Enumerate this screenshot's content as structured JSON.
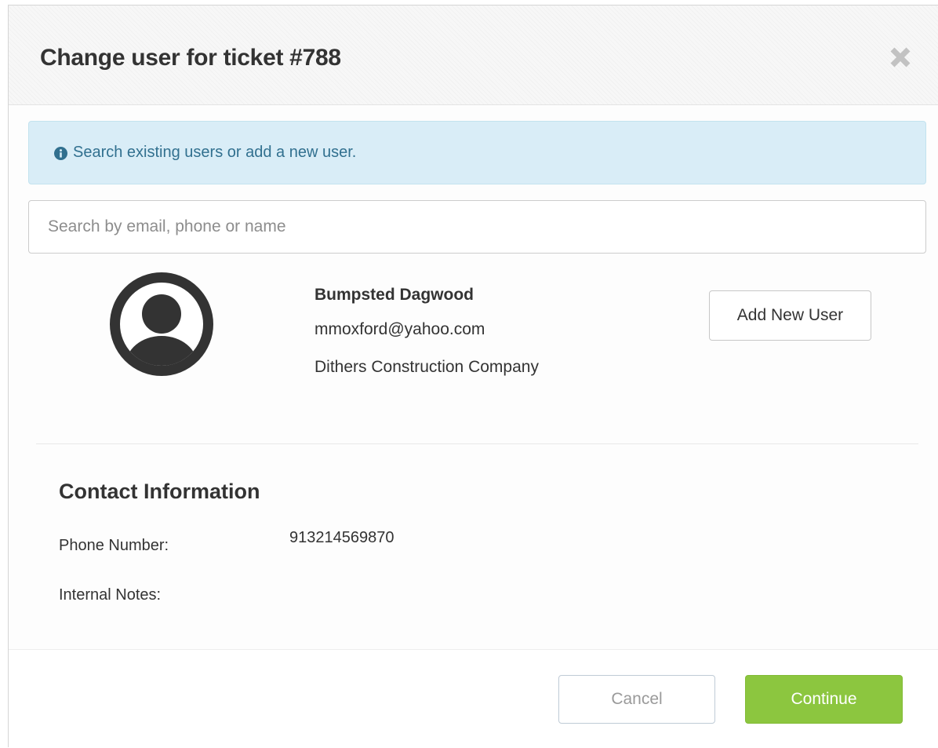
{
  "dialog": {
    "title": "Change user for ticket #788",
    "close_icon": "close-icon"
  },
  "info_alert": {
    "icon": "info-circle-icon",
    "text": "Search existing users or add a new user."
  },
  "search": {
    "value": "",
    "placeholder": "Search by email, phone or name"
  },
  "user": {
    "avatar_icon": "user-avatar-icon",
    "name": "Bumpsted Dagwood",
    "email": "mmoxford@yahoo.com",
    "company": "Dithers Construction Company"
  },
  "add_user_label": "Add New User",
  "contact": {
    "heading": "Contact Information",
    "phone_label": "Phone Number:",
    "phone_value": "913214569870",
    "notes_label": "Internal Notes:",
    "notes_value": ""
  },
  "footer": {
    "cancel_label": "Cancel",
    "continue_label": "Continue"
  },
  "colors": {
    "accent_green": "#8cc63f",
    "info_background": "#d9edf7",
    "info_text": "#31708f",
    "title_text": "#333333"
  }
}
